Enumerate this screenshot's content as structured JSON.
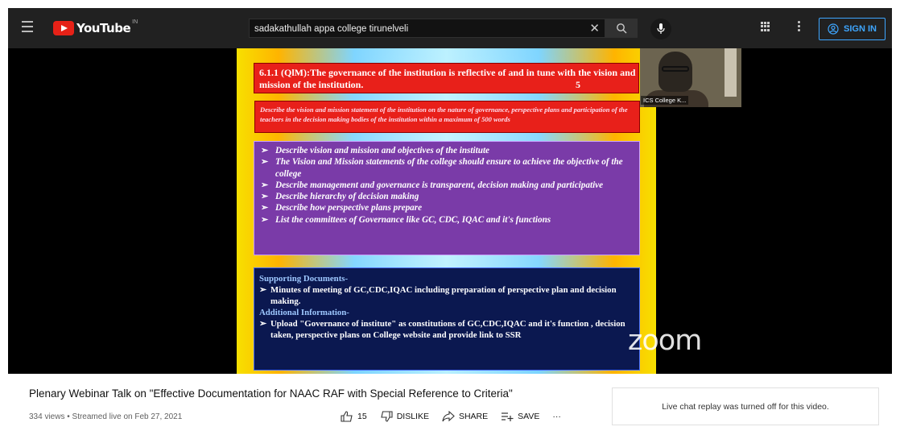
{
  "header": {
    "logo_text": "YouTube",
    "region": "IN",
    "search_value": "sadakathullah appa college tirunelveli",
    "signin_label": "SIGN IN"
  },
  "slide": {
    "box1_text": "6.1.1 (QlM):The governance of the institution is reflective of and in tune with the vision and mission of the institution.",
    "box1_marks": "5",
    "box2_text": "Describe the vision and mission statement of the institution on the nature of governance, perspective plans and participation of the teachers in the decision making bodies of the institution within a maximum of 500 words",
    "bullets": [
      "Describe vision and mission and objectives of the institute",
      " The Vision and Mission statements of the college should ensure to achieve the objective of the college",
      "Describe management and governance is transparent, decision making and participative",
      "Describe hierarchy of decision making",
      "Describe how perspective plans prepare",
      "List the committees of Governance like GC, CDC, IQAC and it's functions"
    ],
    "supporting_heading": "Supporting Documents-",
    "supporting_text": "Minutes of meeting of GC,CDC,IQAC including preparation of perspective plan and decision making.",
    "additional_heading": "Additional Information-",
    "additional_text": "Upload \"Governance of institute\" as constitutions of GC,CDC,IQAC and it's function , decision taken, perspective plans on College website and provide link to SSR",
    "arrow": "➢"
  },
  "participant": {
    "label": "ICS College K..."
  },
  "watermark": "zoom",
  "video_info": {
    "title": "Plenary Webinar Talk on \"Effective Documentation for NAAC RAF with Special Reference to Criteria\"",
    "meta": "334 views • Streamed live on Feb 27, 2021",
    "likes": "15",
    "dislike_label": "DISLIKE",
    "share_label": "SHARE",
    "save_label": "SAVE",
    "more": "···"
  },
  "chat": {
    "message": "Live chat replay was turned off for this video."
  }
}
